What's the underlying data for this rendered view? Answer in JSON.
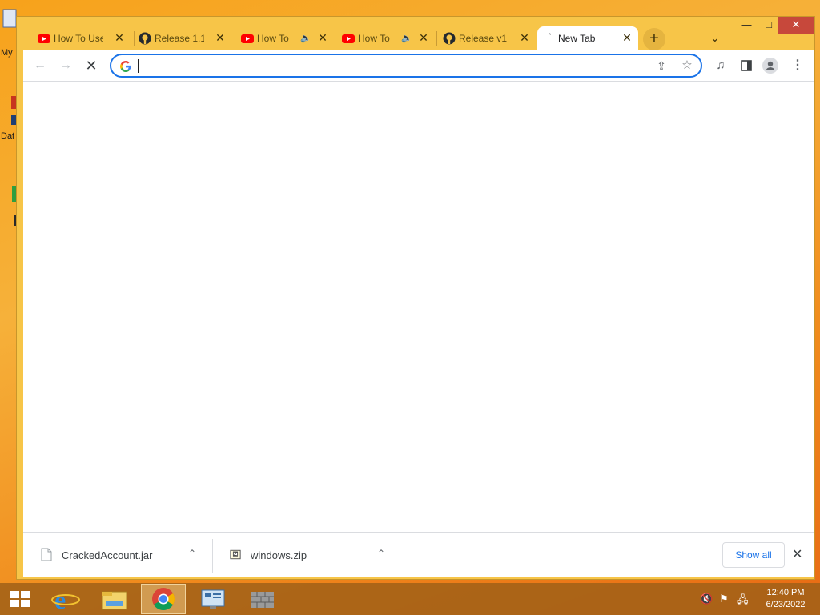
{
  "desktop": {
    "labels": [
      "My",
      "Dat"
    ]
  },
  "browser": {
    "tabs": [
      {
        "title": "How To Use",
        "favicon": "youtube-icon",
        "audio": false,
        "active": false
      },
      {
        "title": "Release 1.1",
        "favicon": "github-icon",
        "audio": false,
        "active": false
      },
      {
        "title": "How To",
        "favicon": "youtube-icon",
        "audio": true,
        "active": false
      },
      {
        "title": "How To",
        "favicon": "youtube-icon",
        "audio": true,
        "active": false
      },
      {
        "title": "Release v1.",
        "favicon": "github-icon",
        "audio": false,
        "active": false
      },
      {
        "title": "New Tab",
        "favicon": "loading-spinner-icon",
        "audio": false,
        "active": true
      }
    ],
    "new_tab_symbol": "+",
    "window_controls": {
      "minimize": "—",
      "maximize": "□",
      "close": "✕"
    },
    "omnibox": {
      "value": "",
      "placeholder": ""
    },
    "colors": {
      "frame": "#f7c548",
      "accent": "#1a73e8",
      "taskbar": "#a06018"
    }
  },
  "downloads": {
    "items": [
      {
        "filename": "CrackedAccount.jar",
        "icon": "file-icon"
      },
      {
        "filename": "windows.zip",
        "icon": "zip-file-icon"
      }
    ],
    "show_all_label": "Show all"
  },
  "taskbar": {
    "time": "12:40 PM",
    "date": "6/23/2022"
  }
}
